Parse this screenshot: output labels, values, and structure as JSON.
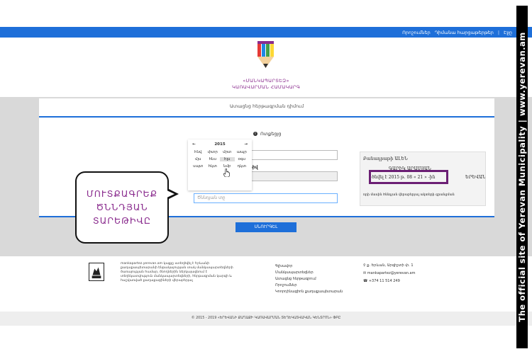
{
  "top_nav": {
    "links": [
      "Որոշումներ",
      "Դիմանա հարցաթերթեր",
      "|",
      "Էջը"
    ]
  },
  "site_title": {
    "line1": "«ՄԱՆԿԱՊԱՐՏԵԶ»",
    "line2": "ԿԱՌԱՎԱՐՄԱՆ ՀԱՄԱԿԱՐԳ"
  },
  "card": {
    "title": "Ատացնց հերթագրման դիմում",
    "help_label": "Ոտքեցյց",
    "field2_label": "ման տարեթիվ",
    "birth_placeholder": "Ծննդյան տը"
  },
  "calendar": {
    "prev": "←",
    "year": "2015",
    "next": "→",
    "months": [
      "հնվ",
      "փտր",
      "մրտ",
      "ապր",
      "մյս",
      "հնս",
      "հլս",
      "օգս",
      "սպտ",
      "հկտ",
      "նմբ",
      "դկտ"
    ]
  },
  "document_preview": {
    "row1": "Բանադրաթի                         ԱԼԵՆ",
    "row2": "ԳԱՐԻԿ ԱՐԱՄՅԱՆ",
    "row3": "ծնվել է   2015   թ.   08    «  21  » -ին",
    "row4": "ԵՐԵՎԱՆ",
    "row5": "որի մասին ծննդյան վերաբերյալ ակտերի գրանցման"
  },
  "bubble": {
    "line1": "ՄՈՒՏՔԱԳՐԵՔ",
    "line2": "ԾՆՆԴՅԱՆ",
    "line3": "ՏԱՐԵԹԻՎԸ"
  },
  "submit_label": "ՍՆՈՒՐԳԵԼ",
  "footer": {
    "about": "mankapartez.yerevan.am կայքը ստեղծվել է Երևանի քաղաքապետարանի ենթակայության տակ մանկապարտեզների ծառայության համար, ծնողներին ներկայացնում է տեղեկատվություն մանկապարտեզների, հերթագրման կարգի և հաշվառված քաղաքացիների վերաբերյալ",
    "links": [
      "Գլխավոր",
      "Մանկապարտեզներ",
      "Ատացնց հերթագրում",
      "Որոշումներ",
      "Կոորդինացիոն քաղաքապետարան"
    ],
    "address": "ք. Երևան, Արգիշտի փ. 1",
    "email": "mankapartez@yerevan.am",
    "phone": "+374 11 514 249",
    "copyright": "© 2015 - 2019 «ԵՐԵՎԱՆԻ ՔԱՂԱՔԻ ԿԱՌԱՎԱՐՄԱՆ ՏԵՂԵԿԱՏՎԱԿԱՆ ԿԵՆՏՐՈՆ» ՓԲԸ"
  },
  "watermark": "The official site of Yerevan Municipality   |   www.yerevan.am",
  "colors": {
    "brand_blue": "#1e6fd9",
    "brand_purple": "#8a2c8e",
    "highlight": "#6b1f74"
  }
}
